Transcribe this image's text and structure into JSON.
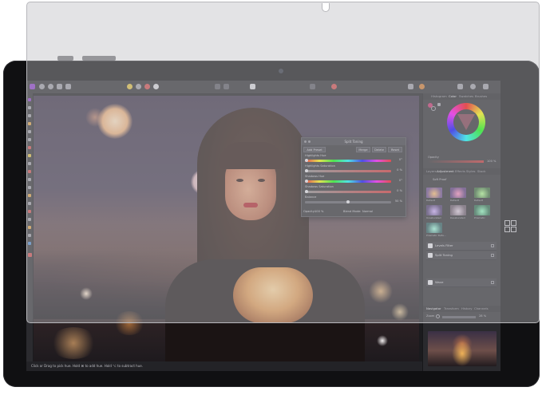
{
  "dialog": {
    "title": "Split Toning",
    "buttons": [
      "Add Preset",
      "Merge",
      "Delete",
      "Reset"
    ],
    "params": [
      {
        "label": "Highlights Hue",
        "value": "0°"
      },
      {
        "label": "Highlights Saturation",
        "value": "0 %"
      },
      {
        "label": "Shadows Hue",
        "value": "0°"
      },
      {
        "label": "Shadows Saturation",
        "value": "0 %"
      },
      {
        "label": "Balance",
        "value": "50 %"
      }
    ],
    "opacity_label": "Opacity:",
    "opacity_value": "100 %",
    "blend_label": "Blend Mode:",
    "blend_value": "Normal"
  },
  "right_panel": {
    "top_tabs": [
      "Histogram",
      "Color",
      "Swatches",
      "Brushes"
    ],
    "active_top_tab": "Color",
    "opacity_label": "Opacity",
    "opacity_value": "100 %",
    "mid_tabs": [
      "Layers",
      "Adjustment",
      "Effects",
      "Styles",
      "Stock"
    ],
    "active_mid_tab": "Adjustment",
    "section_label": "Soft Proof",
    "thumbnails": [
      {
        "label": "Default",
        "color": "#6a4a8a"
      },
      {
        "label": "Default",
        "color": "#5a3a7a"
      },
      {
        "label": "Default",
        "color": "#3a6a3a"
      },
      {
        "label": "Unsaturated",
        "color": "#4a3a6a"
      },
      {
        "label": "Desaturated",
        "color": "#6a5a6a"
      },
      {
        "label": "Prismatic",
        "color": "#2a6a4a"
      }
    ],
    "extra_thumb_label": "Prismatic Defa...",
    "layers": [
      "Levels Filter",
      "Split Toning",
      "Wave"
    ],
    "bottom_tabs": [
      "Navigator",
      "Transform",
      "History",
      "Channels"
    ],
    "zoom_label": "Zoom",
    "zoom_value": "28 %"
  },
  "status": {
    "text": "Click or Drag to pick hue. Hold ⌘ to add hue. Hold ⌥ to subtract hue."
  },
  "colors": {
    "accent": "#8a3cc8",
    "film": "#bcbcc0",
    "screen_bg": "#1b1b1e",
    "panel_bg": "#2a2a2e"
  }
}
